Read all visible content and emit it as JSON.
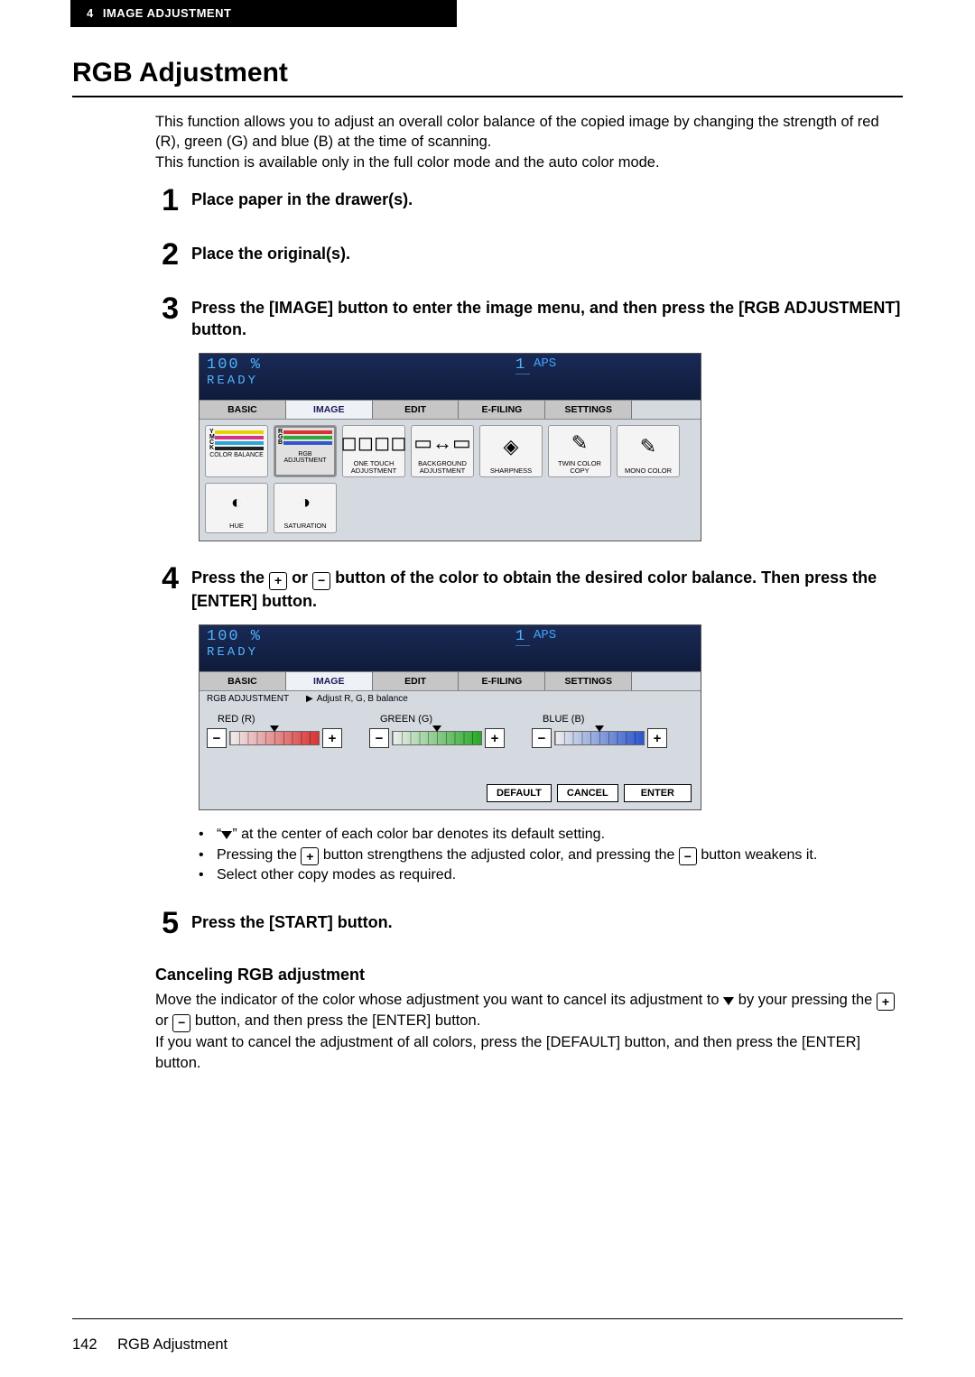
{
  "header": {
    "chapter_num": "4",
    "chapter_title": "IMAGE ADJUSTMENT"
  },
  "title": "RGB Adjustment",
  "intro": {
    "l1": "This function allows you to adjust an overall color balance of the copied image by changing the strength of red (R), green (G) and blue (B) at the time of scanning.",
    "l2": "This function is available only in the full color mode and the auto color mode."
  },
  "steps": {
    "s1": {
      "num": "1",
      "text": "Place paper in the drawer(s)."
    },
    "s2": {
      "num": "2",
      "text": "Place the original(s)."
    },
    "s3": {
      "num": "3",
      "text": "Press the [IMAGE] button to enter the image menu, and then press the [RGB ADJUSTMENT] button."
    },
    "s4": {
      "num": "4",
      "pre": "Press the ",
      "mid": " or ",
      "post": " button of the color to obtain the desired color balance. Then press the [ENTER] button."
    },
    "s5": {
      "num": "5",
      "text": "Press the [START] button."
    }
  },
  "panel_common": {
    "pct": "100  %",
    "ready": "READY",
    "one": "1",
    "aps": "APS",
    "tabs": {
      "basic": "BASIC",
      "image": "IMAGE",
      "edit": "EDIT",
      "efiling": "E-FILING",
      "settings": "SETTINGS"
    }
  },
  "panel1": {
    "color_balance": {
      "y": "Y",
      "m": "M",
      "c": "C",
      "k": "K",
      "label": "COLOR BALANCE"
    },
    "rgb_adj": {
      "r": "R",
      "g": "G",
      "b": "B",
      "label": "RGB\nADJUSTMENT"
    },
    "one_touch": "ONE TOUCH\nADJUSTMENT",
    "bg_adj": "BACKGROUND\nADJUSTMENT",
    "sharpness": "SHARPNESS",
    "twin": "TWIN COLOR\nCOPY",
    "mono": "MONO COLOR",
    "hue": "HUE",
    "saturation": "SATURATION"
  },
  "panel2": {
    "breadcrumb": "RGB ADJUSTMENT",
    "hint_arrow": "▶",
    "hint": "Adjust R, G, B balance",
    "red": "RED (R)",
    "green": "GREEN (G)",
    "blue": "BLUE (B)",
    "default": "DEFAULT",
    "cancel": "CANCEL",
    "enter": "ENTER"
  },
  "bullets": {
    "b1a": "“",
    "b1b": "” at the center of each color bar denotes its default setting.",
    "b2a": "Pressing the ",
    "b2b": " button strengthens the adjusted color, and pressing the ",
    "b2c": " button weakens it.",
    "b3": "Select other copy modes as required."
  },
  "cancel": {
    "heading": "Canceling RGB adjustment",
    "p1a": "Move the indicator of the color whose adjustment you want to cancel its adjustment to ",
    "p1b": " by your pressing the ",
    "p1c": " or ",
    "p1d": " button, and then press the [ENTER] button.",
    "p2": "If you want to cancel the adjustment of all colors, press the [DEFAULT] button, and then press the [ENTER] button."
  },
  "footer": {
    "page": "142",
    "title": "RGB Adjustment"
  }
}
